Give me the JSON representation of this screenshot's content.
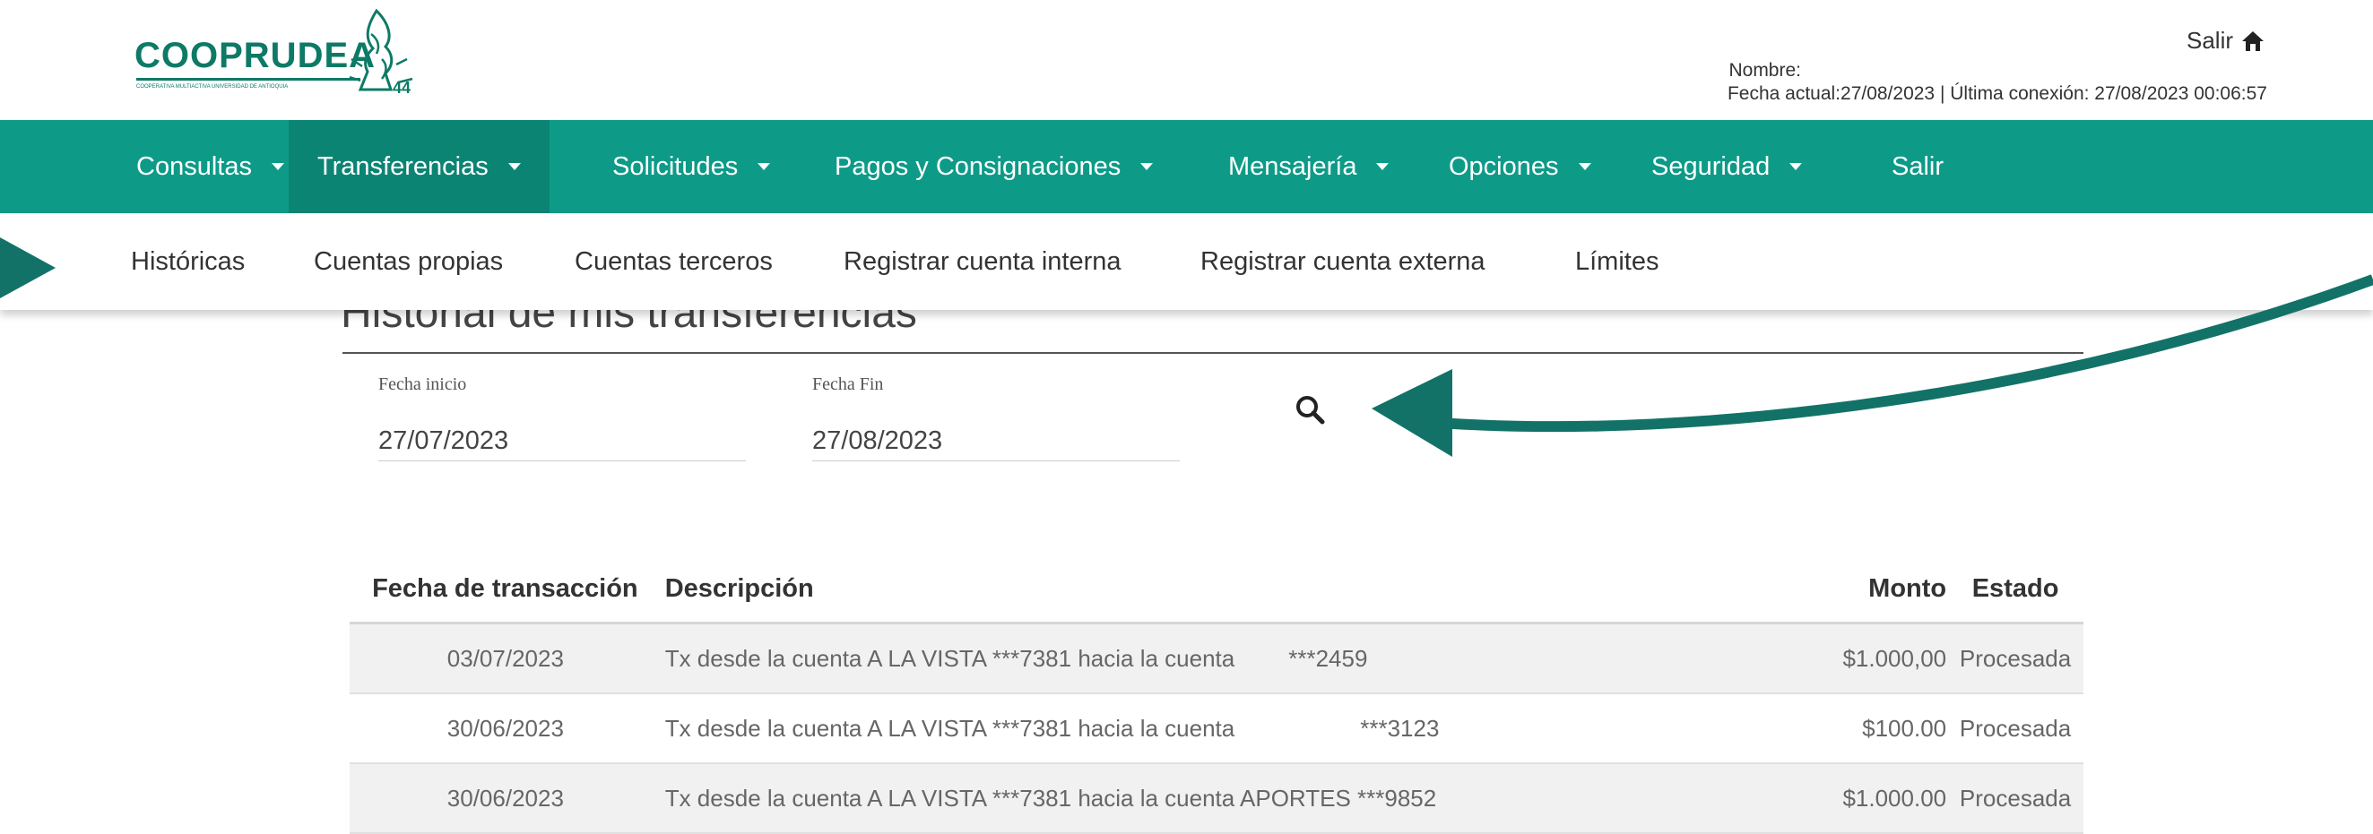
{
  "brand": {
    "name": "COOPRUDEA",
    "tagline": "COOPERATIVA MULTIACTIVA UNIVERSIDAD DE ANTIOQUIA"
  },
  "header": {
    "exit_label": "Salir",
    "name_label": "Nombre:",
    "session": "Fecha actual:27/08/2023 | Última conexión: 27/08/2023 00:06:57"
  },
  "nav": {
    "items": [
      {
        "label": "Consultas"
      },
      {
        "label": "Transferencias"
      },
      {
        "label": "Solicitudes"
      },
      {
        "label": "Pagos y Consignaciones"
      },
      {
        "label": "Mensajería"
      },
      {
        "label": "Opciones"
      },
      {
        "label": "Seguridad"
      },
      {
        "label": "Salir"
      }
    ]
  },
  "subnav": {
    "items": [
      {
        "label": "Históricas"
      },
      {
        "label": "Cuentas propias"
      },
      {
        "label": "Cuentas terceros"
      },
      {
        "label": "Registrar cuenta interna"
      },
      {
        "label": "Registrar cuenta externa"
      },
      {
        "label": "Límites"
      }
    ]
  },
  "page": {
    "title": "Historial de mis transferencias"
  },
  "filters": {
    "start_label": "Fecha inicio",
    "start_value": "27/07/2023",
    "end_label": "Fecha Fin",
    "end_value": "27/08/2023"
  },
  "table": {
    "headers": [
      "Fecha de transacción",
      "Descripción",
      "Monto",
      "Estado"
    ],
    "rows": [
      {
        "date": "03/07/2023",
        "desc": "Tx desde la cuenta A LA VISTA ***7381 hacia la cuenta",
        "dest": "***2459",
        "amount": "$1.000,00",
        "status": "Procesada"
      },
      {
        "date": "30/06/2023",
        "desc": "Tx desde la cuenta A LA VISTA ***7381 hacia la cuenta",
        "dest": "***3123",
        "amount": "$100.00",
        "status": "Procesada"
      },
      {
        "date": "30/06/2023",
        "desc": "Tx desde la cuenta A LA VISTA ***7381 hacia la cuenta APORTES ***9852",
        "dest": "",
        "amount": "$1.000.00",
        "status": "Procesada"
      }
    ]
  },
  "colors": {
    "nav_bg": "#0d9b88",
    "nav_active": "#0b8474",
    "brand": "#0d7a66",
    "arrow": "#137268"
  },
  "icons": {
    "home": "home-icon",
    "search": "search-icon"
  }
}
